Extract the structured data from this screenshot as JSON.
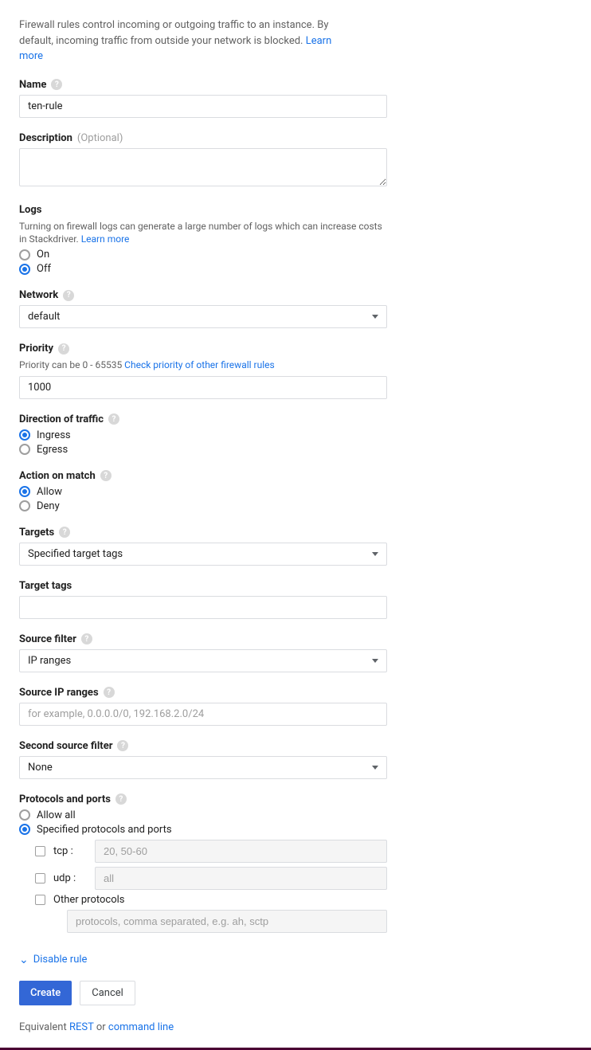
{
  "intro": {
    "text": "Firewall rules control incoming or outgoing traffic to an instance. By default, incoming traffic from outside your network is blocked.",
    "learn_more": "Learn more"
  },
  "name": {
    "label": "Name",
    "value": "ten-rule"
  },
  "description": {
    "label": "Description",
    "optional": "(Optional)",
    "value": ""
  },
  "logs": {
    "label": "Logs",
    "help": "Turning on firewall logs can generate a large number of logs which can increase costs in Stackdriver.",
    "learn_more": "Learn more",
    "options": {
      "on": "On",
      "off": "Off"
    },
    "selected": "off"
  },
  "network": {
    "label": "Network",
    "value": "default"
  },
  "priority": {
    "label": "Priority",
    "help_prefix": "Priority can be 0 - 65535",
    "help_link": "Check priority of other firewall rules",
    "value": "1000"
  },
  "direction": {
    "label": "Direction of traffic",
    "options": {
      "ingress": "Ingress",
      "egress": "Egress"
    },
    "selected": "ingress"
  },
  "action": {
    "label": "Action on match",
    "options": {
      "allow": "Allow",
      "deny": "Deny"
    },
    "selected": "allow"
  },
  "targets": {
    "label": "Targets",
    "value": "Specified target tags"
  },
  "target_tags": {
    "label": "Target tags",
    "value": ""
  },
  "source_filter": {
    "label": "Source filter",
    "value": "IP ranges"
  },
  "source_ip": {
    "label": "Source IP ranges",
    "placeholder": "for example, 0.0.0.0/0, 192.168.2.0/24",
    "value": ""
  },
  "second_source": {
    "label": "Second source filter",
    "value": "None"
  },
  "protocols": {
    "label": "Protocols and ports",
    "options": {
      "all": "Allow all",
      "spec": "Specified protocols and ports"
    },
    "selected": "spec",
    "tcp": {
      "label": "tcp :",
      "placeholder": "20, 50-60"
    },
    "udp": {
      "label": "udp :",
      "placeholder": "all"
    },
    "other_label": "Other protocols",
    "other_placeholder": "protocols, comma separated, e.g. ah, sctp"
  },
  "disable_rule": "Disable rule",
  "buttons": {
    "create": "Create",
    "cancel": "Cancel"
  },
  "equiv": {
    "prefix": "Equivalent",
    "rest": "REST",
    "or": "or",
    "cmd": "command line"
  }
}
